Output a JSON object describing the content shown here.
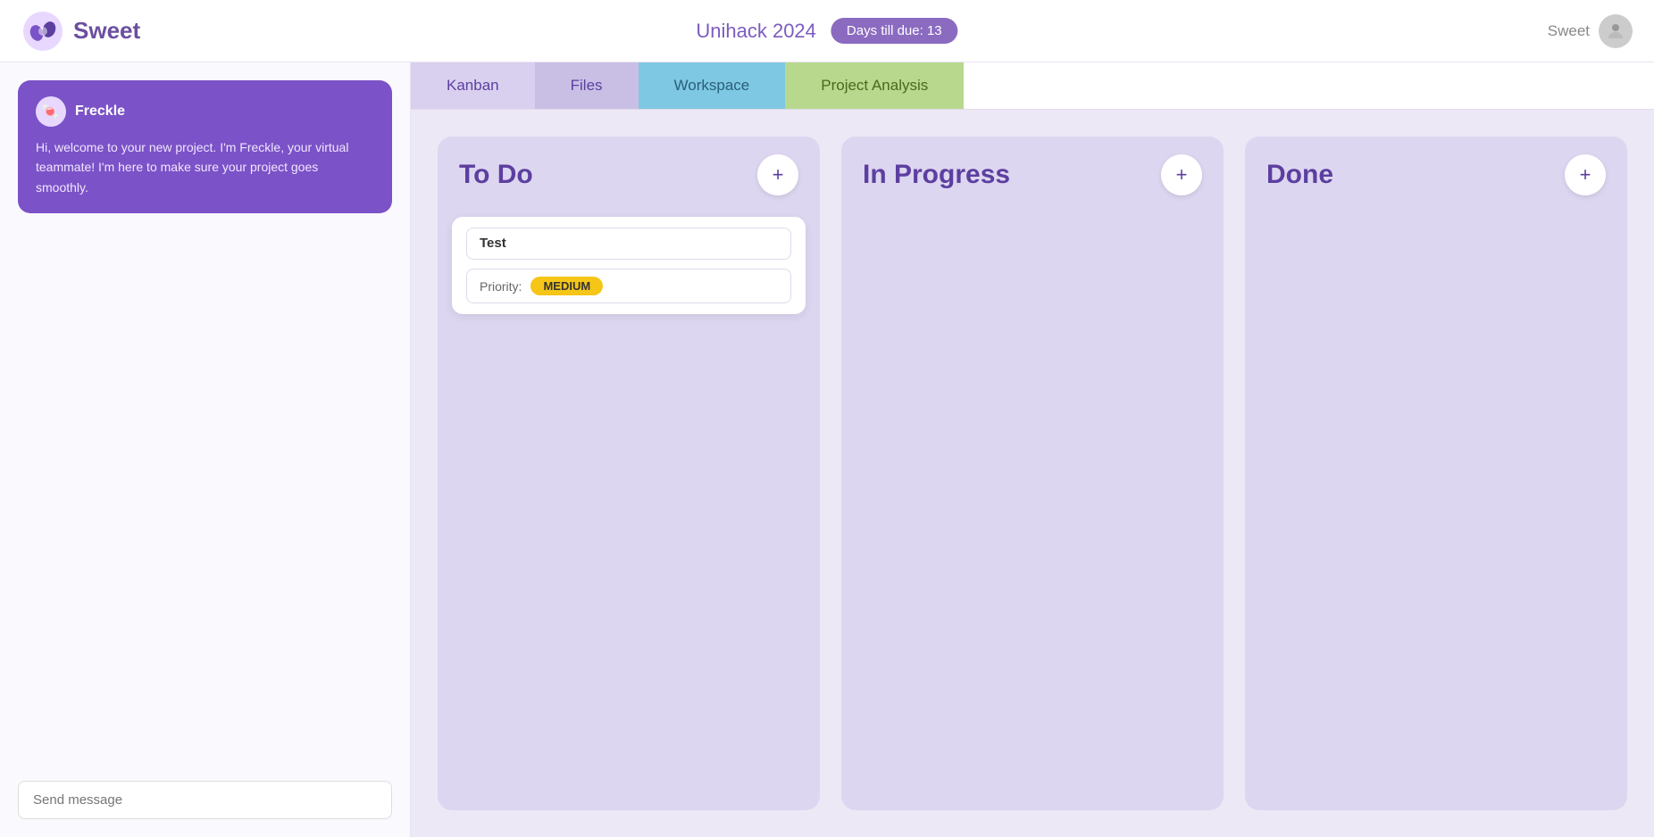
{
  "header": {
    "logo_text": "Sweet",
    "project_title": "Unihack 2024",
    "days_badge": "Days till due: 13",
    "user_name": "Sweet"
  },
  "tabs": [
    {
      "id": "kanban",
      "label": "Kanban",
      "active": true,
      "style": "active-kanban"
    },
    {
      "id": "files",
      "label": "Files",
      "active": false,
      "style": "active-files"
    },
    {
      "id": "workspace",
      "label": "Workspace",
      "active": false,
      "style": "active-workspace"
    },
    {
      "id": "project-analysis",
      "label": "Project Analysis",
      "active": false,
      "style": "active-analysis"
    }
  ],
  "sidebar": {
    "freckle": {
      "name": "Freckle",
      "message": "Hi, welcome to your new project. I'm Freckle, your virtual teammate! I'm here to make sure your project goes smoothly."
    },
    "chat_placeholder": "Send message"
  },
  "kanban": {
    "columns": [
      {
        "id": "todo",
        "title": "To Do",
        "cards": [
          {
            "id": "card-1",
            "title": "Test",
            "priority_label": "Priority:",
            "priority": "MEDIUM"
          }
        ]
      },
      {
        "id": "in-progress",
        "title": "In Progress",
        "cards": []
      },
      {
        "id": "done",
        "title": "Done",
        "cards": []
      }
    ]
  },
  "icons": {
    "plus": "+",
    "user": "👤",
    "freckle_emoji": "🍬"
  }
}
